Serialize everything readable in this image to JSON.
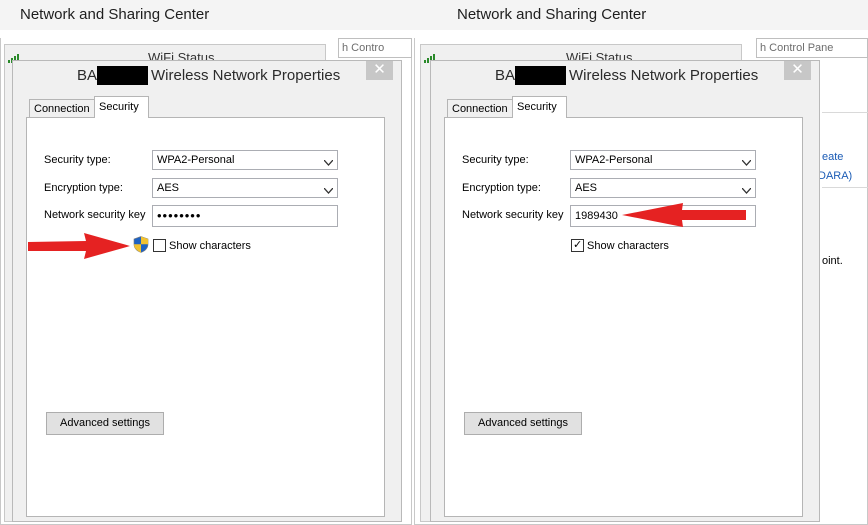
{
  "background_windows": {
    "left_title": "Network and Sharing Center",
    "right_title": "Network and Sharing Center",
    "left_search_partial": "h Contro",
    "right_search_partial": "h Control Pane",
    "right_link1_partial": "eate",
    "right_link2_partial": "DARA)",
    "right_text_partial": "oint."
  },
  "wifi_status": {
    "left": "WiFi Status",
    "right": "WiFi Status"
  },
  "left_dialog": {
    "title_prefix": "BAN",
    "title_suffix": "Wireless Network Properties",
    "close_glyph": "✕",
    "tabs": [
      "Connection",
      "Security"
    ],
    "active_tab": "Security",
    "security_type_label": "Security type:",
    "security_type_value": "WPA2-Personal",
    "encryption_type_label": "Encryption type:",
    "encryption_type_value": "AES",
    "key_label": "Network security key",
    "key_value": "••••••••",
    "show_characters_label": "Show characters",
    "show_characters_checked": false,
    "advanced_button": "Advanced settings"
  },
  "right_dialog": {
    "title_prefix": "BAN",
    "title_suffix": "Wireless Network Properties",
    "close_glyph": "✕",
    "tabs": [
      "Connection",
      "Security"
    ],
    "active_tab": "Security",
    "security_type_label": "Security type:",
    "security_type_value": "WPA2-Personal",
    "encryption_type_label": "Encryption type:",
    "encryption_type_value": "AES",
    "key_label": "Network security key",
    "key_value": "1989430",
    "show_characters_label": "Show characters",
    "show_characters_checked": true,
    "check_glyph": "✓",
    "advanced_button": "Advanced settings"
  },
  "annotations": {
    "arrow_color": "#e52222",
    "arrow_icon": "red-arrow-icon"
  },
  "icons": {
    "uac_shield": "uac-shield-icon",
    "wifi_signal": "wifi-signal-icon",
    "dropdown": "chevron-down-icon"
  }
}
